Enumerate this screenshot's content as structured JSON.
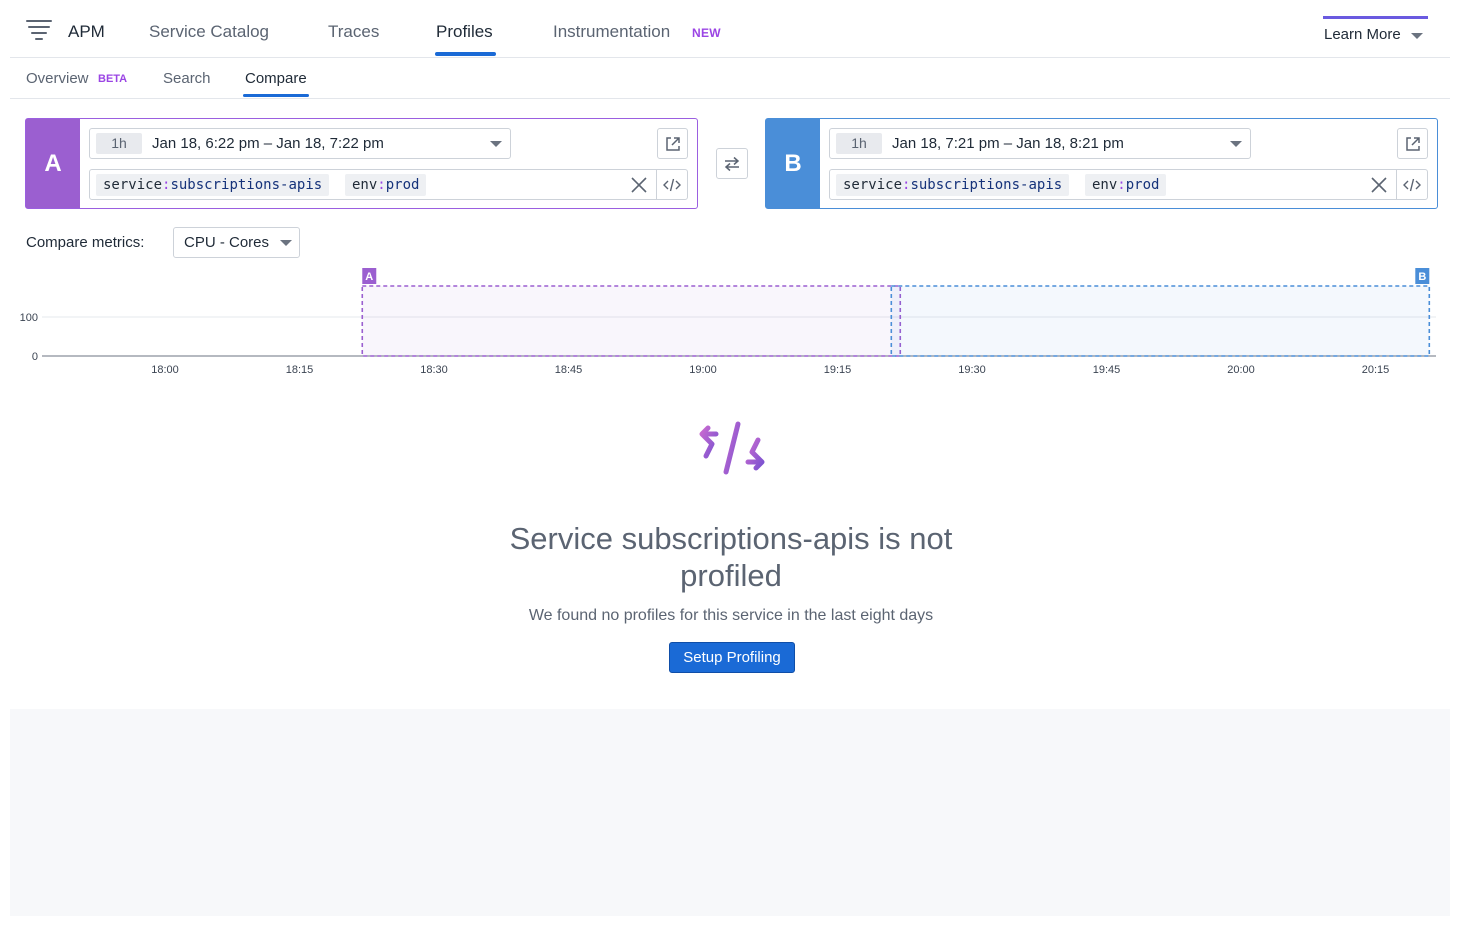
{
  "nav": {
    "apm": "APM",
    "service_catalog": "Service Catalog",
    "traces": "Traces",
    "profiles": "Profiles",
    "instrumentation": "Instrumentation",
    "instrumentation_badge": "NEW",
    "learn_more": "Learn More"
  },
  "subnav": {
    "overview": "Overview",
    "overview_badge": "BETA",
    "search": "Search",
    "compare": "Compare"
  },
  "query_a": {
    "letter": "A",
    "duration": "1h",
    "time_range": "Jan 18, 6:22 pm – Jan 18, 7:22 pm",
    "tags": [
      {
        "key": "service",
        "sep": ":",
        "value": "subscriptions-apis"
      },
      {
        "key": "env",
        "sep": ":",
        "value": "prod"
      }
    ]
  },
  "query_b": {
    "letter": "B",
    "duration": "1h",
    "time_range": "Jan 18, 7:21 pm – Jan 18, 8:21 pm",
    "tags": [
      {
        "key": "service",
        "sep": ":",
        "value": "subscriptions-apis"
      },
      {
        "key": "env",
        "sep": ":",
        "value": "prod"
      }
    ]
  },
  "metrics": {
    "label": "Compare metrics:",
    "selected": "CPU - Cores"
  },
  "chart_data": {
    "type": "area",
    "x_ticks": [
      "18:00",
      "18:15",
      "18:30",
      "18:45",
      "19:00",
      "19:15",
      "19:30",
      "19:45",
      "20:00",
      "20:15"
    ],
    "y_ticks": [
      0,
      100
    ],
    "series": [],
    "selections": [
      {
        "label": "A",
        "start": "18:22",
        "end": "19:22",
        "color": "#9b5fd0"
      },
      {
        "label": "B",
        "start": "19:21",
        "end": "20:21",
        "color": "#4a8ed8"
      }
    ],
    "grid": true
  },
  "empty_state": {
    "title": "Service subscriptions-apis is not profiled",
    "subtitle": "We found no profiles for this service in the last eight days",
    "button": "Setup Profiling"
  },
  "colors": {
    "accent": "#1a6ad6",
    "query_a": "#9b5fd0",
    "query_b": "#4a8ed8",
    "badge": "#9b45e4"
  }
}
